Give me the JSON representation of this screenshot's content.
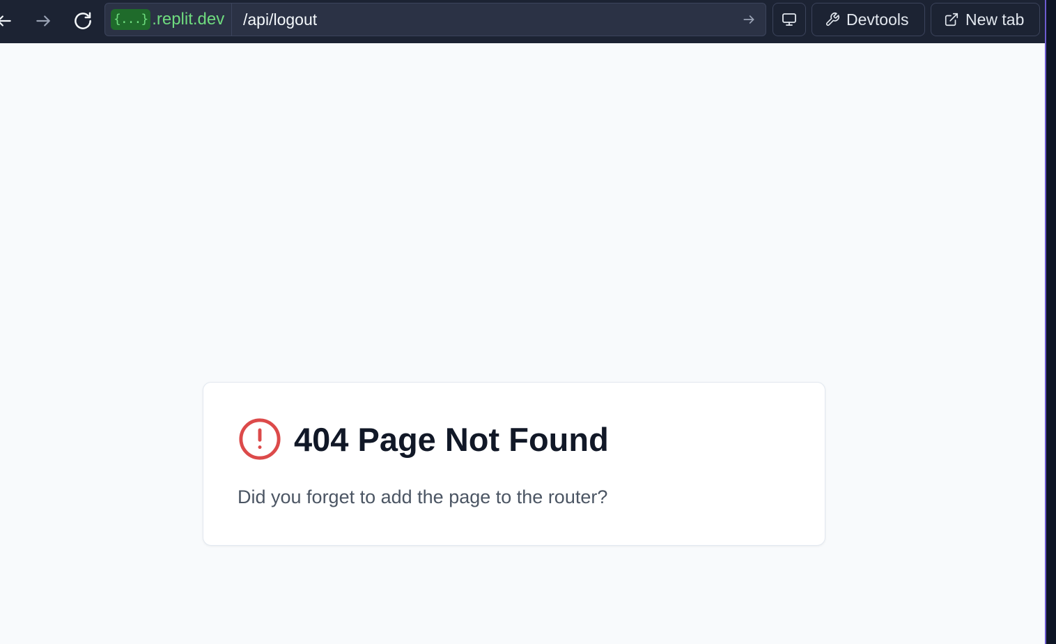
{
  "browser": {
    "host_chip": "{...}",
    "host_domain": ".replit.dev",
    "path": "/api/logout",
    "devtools_label": "Devtools",
    "new_tab_label": "New tab"
  },
  "error_card": {
    "title": "404 Page Not Found",
    "message": "Did you forget to add the page to the router?"
  },
  "colors": {
    "toolbar_bg": "#1c2333",
    "host_green": "#6fdc7f",
    "error_red": "#dc4a4a",
    "page_bg": "#f8fafc"
  },
  "icons": {
    "back": "arrow-left-icon",
    "forward": "arrow-right-icon",
    "reload": "reload-icon",
    "go": "arrow-right-icon",
    "screen": "monitor-icon",
    "devtools": "wrench-icon",
    "new_tab": "external-link-icon",
    "error": "alert-circle-icon"
  }
}
